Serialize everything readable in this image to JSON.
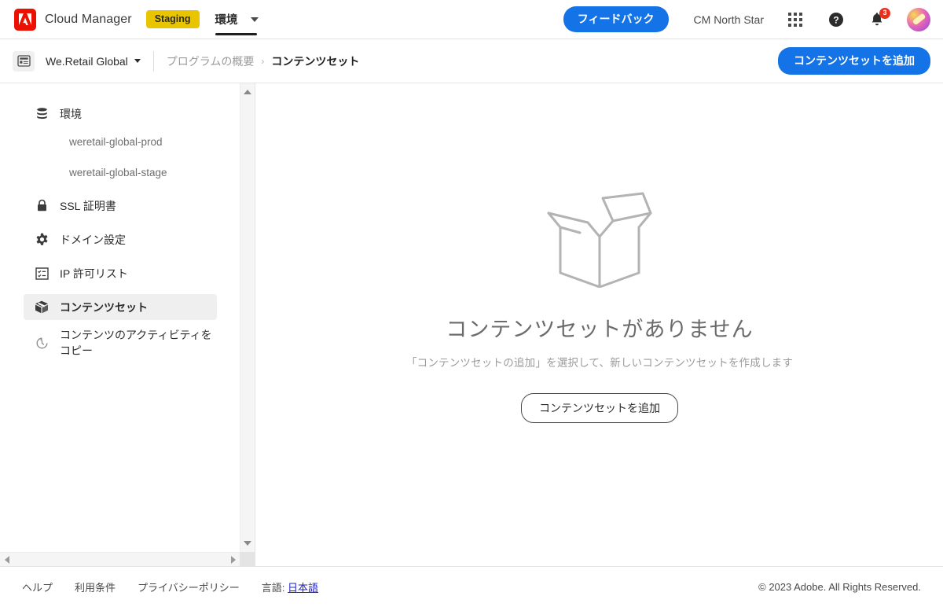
{
  "header": {
    "logo_icon": "adobe-logo-icon",
    "app_title": "Cloud Manager",
    "env_badge": "Staging",
    "nav_tab": "環境",
    "feedback_label": "フィードバック",
    "org_name": "CM North Star",
    "apps_icon": "app-grid-icon",
    "help_icon": "help-circle-icon",
    "bell_icon": "bell-icon",
    "notification_count": "3",
    "avatar_icon": "user-avatar"
  },
  "breadcrumb": {
    "program_icon": "program-dashboard-icon",
    "program_name": "We.Retail Global",
    "parent_link": "プログラムの概要",
    "separator": "›",
    "current": "コンテンツセット",
    "add_button": "コンテンツセットを追加"
  },
  "sidebar": {
    "items": [
      {
        "label": "環境",
        "icon": "database-icon",
        "selected": false
      },
      {
        "label": "weretail-global-prod",
        "icon": "",
        "selected": false
      },
      {
        "label": "weretail-global-stage",
        "icon": "",
        "selected": false
      },
      {
        "label": "SSL 証明書",
        "icon": "lock-icon",
        "selected": false
      },
      {
        "label": "ドメイン設定",
        "icon": "gear-icon",
        "selected": false
      },
      {
        "label": "IP 許可リスト",
        "icon": "list-box-icon",
        "selected": false
      },
      {
        "label": "コンテンツセット",
        "icon": "package-icon",
        "selected": true
      },
      {
        "label": "コンテンツのアクティビティをコピー",
        "icon": "history-clock-icon",
        "selected": false
      }
    ],
    "scroll_up_icon": "scroll-up-arrow",
    "scroll_down_icon": "scroll-down-arrow",
    "scroll_left_icon": "scroll-left-arrow",
    "scroll_right_icon": "scroll-right-arrow"
  },
  "empty_state": {
    "illustration_icon": "open-box-icon",
    "title": "コンテンツセットがありません",
    "subtitle": "「コンテンツセットの追加」を選択して、新しいコンテンツセットを作成します",
    "cta_label": "コンテンツセットを追加"
  },
  "footer": {
    "help": "ヘルプ",
    "terms": "利用条件",
    "privacy": "プライバシーポリシー",
    "language_label": "言語:",
    "language_value": "日本語",
    "copyright": "© 2023 Adobe. All Rights Reserved."
  },
  "colors": {
    "accent_blue": "#1473e6",
    "staging_yellow": "#e8c500",
    "adobe_red": "#eb1000",
    "notification_red": "#e8301c",
    "selected_grey": "#efefef"
  }
}
